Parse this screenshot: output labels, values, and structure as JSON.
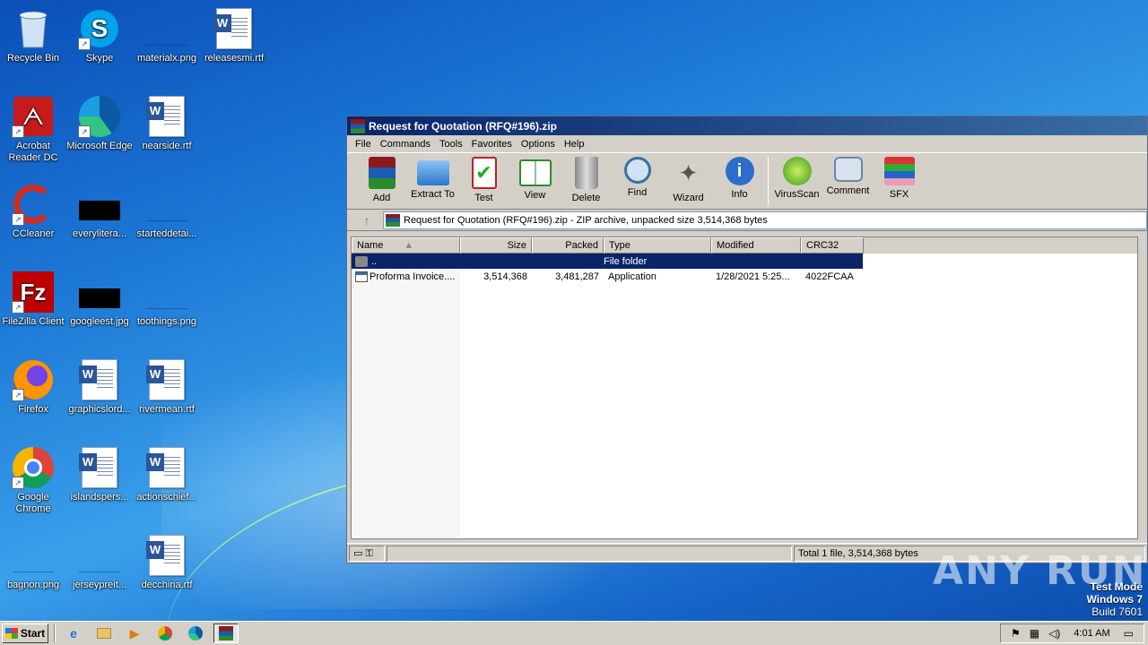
{
  "desktop": {
    "icons": [
      {
        "label": "Recycle Bin",
        "icon": "recycle-bin-icon"
      },
      {
        "label": "Skype",
        "icon": "skype-icon"
      },
      {
        "label": "materialx.png",
        "icon": "image-file-icon"
      },
      {
        "label": "releasesmi.rtf",
        "icon": "word-document-icon"
      },
      {
        "label": "Acrobat Reader DC",
        "icon": "acrobat-icon"
      },
      {
        "label": "Microsoft Edge",
        "icon": "edge-icon"
      },
      {
        "label": "nearside.rtf",
        "icon": "word-document-icon"
      },
      {
        "label": "CCleaner",
        "icon": "ccleaner-icon"
      },
      {
        "label": "everylitera...",
        "icon": "image-file-icon"
      },
      {
        "label": "starteddetai...",
        "icon": "image-file-icon"
      },
      {
        "label": "FileZilla Client",
        "icon": "filezilla-icon"
      },
      {
        "label": "googleest.jpg",
        "icon": "image-file-icon"
      },
      {
        "label": "toothings.png",
        "icon": "image-file-icon"
      },
      {
        "label": "Firefox",
        "icon": "firefox-icon"
      },
      {
        "label": "graphicslord...",
        "icon": "word-document-icon"
      },
      {
        "label": "rivermean.rtf",
        "icon": "word-document-icon"
      },
      {
        "label": "Google Chrome",
        "icon": "chrome-icon"
      },
      {
        "label": "islandspers...",
        "icon": "word-document-icon"
      },
      {
        "label": "actionschief...",
        "icon": "word-document-icon"
      },
      {
        "label": "bagnon.png",
        "icon": "image-file-icon"
      },
      {
        "label": "jerseypreit...",
        "icon": "image-file-icon"
      },
      {
        "label": "decchina.rtf",
        "icon": "word-document-icon"
      }
    ]
  },
  "window": {
    "title": "Request for Quotation (RFQ#196).zip",
    "menu": [
      "File",
      "Commands",
      "Tools",
      "Favorites",
      "Options",
      "Help"
    ],
    "toolbar": [
      "Add",
      "Extract To",
      "Test",
      "View",
      "Delete",
      "Find",
      "Wizard",
      "Info",
      "VirusScan",
      "Comment",
      "SFX"
    ],
    "address": "Request for Quotation (RFQ#196).zip - ZIP archive, unpacked size 3,514,368 bytes",
    "columns": [
      "Name",
      "Size",
      "Packed",
      "Type",
      "Modified",
      "CRC32"
    ],
    "rows": [
      {
        "name": "..",
        "size": "",
        "packed": "",
        "type": "File folder",
        "modified": "",
        "crc": ""
      },
      {
        "name": "Proforma Invoice....",
        "size": "3,514,368",
        "packed": "3,481,287",
        "type": "Application",
        "modified": "1/28/2021 5:25...",
        "crc": "4022FCAA"
      }
    ],
    "status": "Total 1 file, 3,514,368 bytes"
  },
  "overlay": {
    "watermark": "ANY RUN",
    "testmode_line1": "Test Mode",
    "testmode_line2": "Windows 7",
    "testmode_line3": "Build 7601"
  },
  "taskbar": {
    "start_label": "Start",
    "clock": "4:01 AM"
  }
}
